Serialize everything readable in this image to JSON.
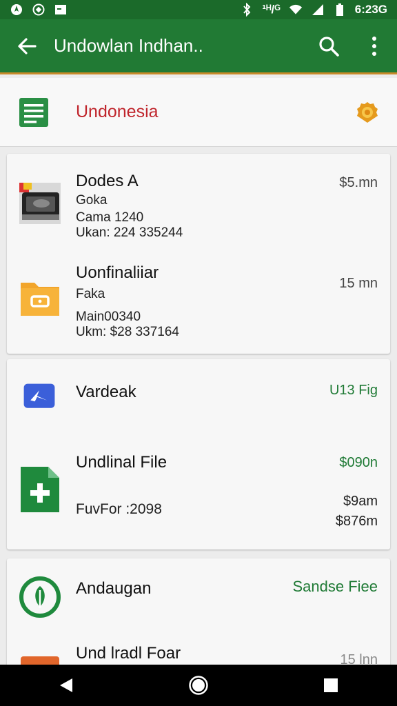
{
  "status_bar": {
    "left_icons": [
      "notification-icon",
      "target-icon",
      "image-icon"
    ],
    "network_label": "¹ᴴ/ᴳ",
    "time": "6:23G",
    "right_icons": [
      "bluetooth-icon",
      "wifi-icon",
      "signal-icon",
      "battery-icon"
    ]
  },
  "app_bar": {
    "title": "Undowlan Indhan..",
    "back_icon": "arrow-back-icon",
    "search_icon": "search-icon",
    "menu_icon": "more-vert-icon"
  },
  "header": {
    "label": "Undonesia",
    "icon": "document-icon",
    "badge_icon": "badge-icon"
  },
  "cards": [
    {
      "items": [
        {
          "name": "Dodes A",
          "lines": [
            "Goka",
            "Cama 1240",
            "Ukan: 224 335244"
          ],
          "meta": [
            "$5.mn"
          ],
          "icon": "device-thumbnail"
        },
        {
          "name": "Uonfinaliiar",
          "lines": [
            "Faka",
            "Main00340",
            "Ukm: $28 337164"
          ],
          "meta": [
            "15 mn"
          ],
          "icon": "folder-icon"
        }
      ]
    },
    {
      "items": [
        {
          "name": "Vardeak",
          "lines": [],
          "meta": [
            "U13 Fig"
          ],
          "icon": "app-k-icon"
        },
        {
          "name": "Undlinal File",
          "lines": [
            "FuvFor :2098"
          ],
          "meta": [
            "$090n",
            "$9am",
            "$876m"
          ],
          "icon": "add-file-icon"
        }
      ]
    },
    {
      "items": [
        {
          "name": "Andaugan",
          "lines": [],
          "meta": [
            "Sandse Fiee"
          ],
          "icon": "leaf-circle-icon"
        },
        {
          "name": "Und lradl Foar",
          "lines": [],
          "meta": [
            "15 lnn"
          ],
          "icon": "orange-file-icon"
        }
      ]
    }
  ],
  "nav_bar": {
    "back_icon": "nav-back-icon",
    "home_icon": "nav-home-icon",
    "recents_icon": "nav-recents-icon"
  },
  "colors": {
    "status_bar": "#1b6a2a",
    "app_bar": "#217a34",
    "accent_red": "#c0262d",
    "accent_green": "#1f7a35"
  }
}
